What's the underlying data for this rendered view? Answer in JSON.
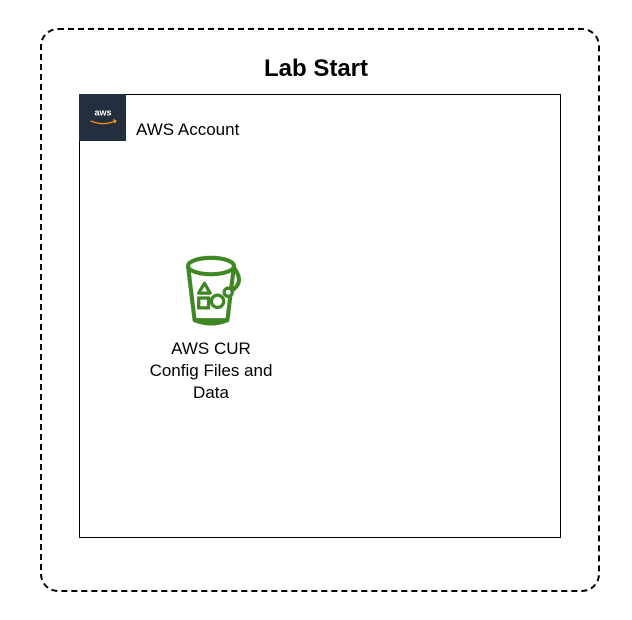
{
  "diagram": {
    "title": "Lab Start",
    "account": {
      "label": "AWS Account",
      "logo_text": "aws"
    },
    "bucket": {
      "label_line1": "AWS CUR",
      "label_line2": "Config Files and",
      "label_line3": "Data",
      "icon_name": "s3-bucket-with-shapes",
      "color": "#3F8624"
    }
  }
}
